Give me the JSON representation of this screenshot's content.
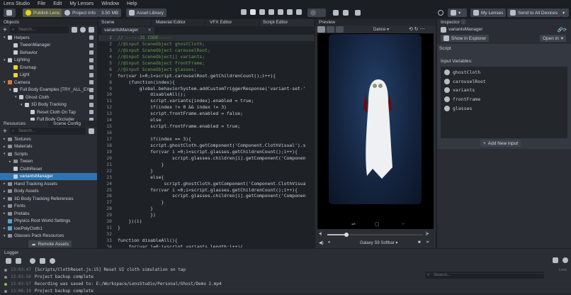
{
  "menu": [
    "Lens Studio",
    "File",
    "Edit",
    "My Lenses",
    "Window",
    "Help"
  ],
  "toolbar": {
    "publish": "Publish Lens",
    "project_info": "Project Info",
    "size": "3.50 MB",
    "asset_library": "Asset Library",
    "my_lenses": "My Lenses",
    "send": "Send to All Devices"
  },
  "objects": {
    "title": "Objects",
    "search": "Search...",
    "items": [
      {
        "label": "Helpers",
        "depth": 0,
        "arrow": "v",
        "icon": "group"
      },
      {
        "label": "TweenManager",
        "depth": 1,
        "arrow": "",
        "icon": "script"
      },
      {
        "label": "Behavior",
        "depth": 1,
        "arrow": "",
        "icon": "script"
      },
      {
        "label": "Lighting",
        "depth": 0,
        "arrow": "v",
        "icon": "group"
      },
      {
        "label": "Envmap",
        "depth": 1,
        "arrow": "",
        "icon": "light"
      },
      {
        "label": "Light",
        "depth": 1,
        "arrow": "",
        "icon": "light"
      },
      {
        "label": "Camera",
        "depth": 0,
        "arrow": "v",
        "icon": "camera"
      },
      {
        "label": "Full Body Examples [TRY_ALL_EX",
        "depth": 1,
        "arrow": "v",
        "icon": "group"
      },
      {
        "label": "Ghost Cloth",
        "depth": 2,
        "arrow": "v",
        "icon": "group"
      },
      {
        "label": "3D Body Tracking",
        "depth": 3,
        "arrow": "v",
        "icon": "tracking"
      },
      {
        "label": "Reset Cloth On Tap",
        "depth": 4,
        "arrow": "",
        "icon": "script"
      },
      {
        "label": "Full Body Occluder",
        "depth": 4,
        "arrow": "",
        "icon": "tracking"
      }
    ]
  },
  "resources": {
    "tab1": "Resources",
    "tab2": "Scene Config",
    "search": "Search...",
    "items": [
      {
        "label": "Textures",
        "depth": 0,
        "arrow": ">",
        "icon": "folder"
      },
      {
        "label": "Materials",
        "depth": 0,
        "arrow": ">",
        "icon": "folder"
      },
      {
        "label": "Scripts",
        "depth": 0,
        "arrow": "v",
        "icon": "folder"
      },
      {
        "label": "Tween",
        "depth": 1,
        "arrow": ">",
        "icon": "folder"
      },
      {
        "label": "ClothReset",
        "depth": 1,
        "arrow": "",
        "icon": "script"
      },
      {
        "label": "variantsManager",
        "depth": 1,
        "arrow": "",
        "icon": "script",
        "selected": true
      },
      {
        "label": "Hand Tracking Assets",
        "depth": 0,
        "arrow": ">",
        "icon": "folder"
      },
      {
        "label": "Body Assets",
        "depth": 0,
        "arrow": ">",
        "icon": "folder"
      },
      {
        "label": "3D Body Tracking References",
        "depth": 0,
        "arrow": ">",
        "icon": "folder"
      },
      {
        "label": "Fonts",
        "depth": 0,
        "arrow": ">",
        "icon": "folder"
      },
      {
        "label": "Prefabs",
        "depth": 0,
        "arrow": ">",
        "icon": "folder"
      },
      {
        "label": "Physics Root World Settings",
        "depth": 0,
        "arrow": "",
        "icon": "physics"
      },
      {
        "label": "lowPolyCloth1",
        "depth": 0,
        "arrow": ">",
        "icon": "mesh"
      },
      {
        "label": "Glasses Pack Resources",
        "depth": 0,
        "arrow": "v",
        "icon": "folder"
      }
    ],
    "remote": "Remote Assets"
  },
  "editor": {
    "tabs": [
      "Scene",
      "Material Editor",
      "VFX Editor",
      "Script Editor"
    ],
    "file_tab": "variantsManager",
    "close": "×",
    "lines": [
      "// -----JS CODE-----",
      "//@input SceneObject ghostCloth;",
      "//@input SceneObject carouselRoot;",
      "//@input SceneObject[] variants;",
      "//@input SceneObject frontFrame;",
      "//@input SceneObject glasses;",
      "for(var i=0;i<script.carouselRoot.getChildrenCount();i++){",
      "    (function(index){",
      "        global.behaviorSystem.addCustomTriggerResponse('variant-set-'",
      "            disableAll();",
      "            script.variants[index].enabled = true;",
      "            if(index != 0 && index != 3)",
      "            script.frontFrame.enabled = false;",
      "            else",
      "            script.frontFrame.enabled = true;",
      "",
      "            if(index == 3){",
      "            script.ghostCloth.getComponent('Component.ClothVisual').s",
      "            for(var i =0;i<script.glasses.getChildrenCount();i++){",
      "                    script.glasses.children[i].getComponent('Componen",
      "                }",
      "            }",
      "            else{",
      "                 script.ghostCloth.getComponent('Component.ClothVisua",
      "            for(var i =0;i<script.glasses.getChildrenCount();i++){",
      "                    script.glasses.children[i].getComponent('Componen",
      "                }",
      "            }",
      "            })",
      "    })(i)",
      "}",
      "",
      "function disableAll(){",
      "    for(var i=0;i<script.variants.length;i++){"
    ]
  },
  "preview": {
    "title": "Preview",
    "animation": "Dance",
    "device": "Galaxy S9 Softbar",
    "slider_value": 0.2
  },
  "inspector": {
    "title": "Inspector",
    "file": "variantsManager",
    "show_explorer": "Show in Explorer",
    "open_in": "Open in",
    "section": "Script",
    "input_label": "Input Variables:",
    "vars": [
      "ghostCloth",
      "carouselRoot",
      "variants",
      "frontFrame",
      "glasses"
    ],
    "add_input": "Add New input"
  },
  "logger": {
    "title": "Logger",
    "search": "Search...",
    "col": "Lens",
    "rows": [
      {
        "time": "13:03:47",
        "msg": "[Scripts/ClothReset.js:15] Reset UI cloth simulation on tap",
        "status": "#8a8f96"
      },
      {
        "time": "13:03:50",
        "msg": "Project backup complete",
        "status": "#8a8f96"
      },
      {
        "time": "13:03:57",
        "msg": "Recording was saved to:  E:/Workspace/LensStudio/Personal/Ghost/Demo 2.mp4",
        "status": "#7ac943"
      },
      {
        "time": "13:06:10",
        "msg": "Project backup complete",
        "status": "#8a8f96"
      }
    ]
  }
}
